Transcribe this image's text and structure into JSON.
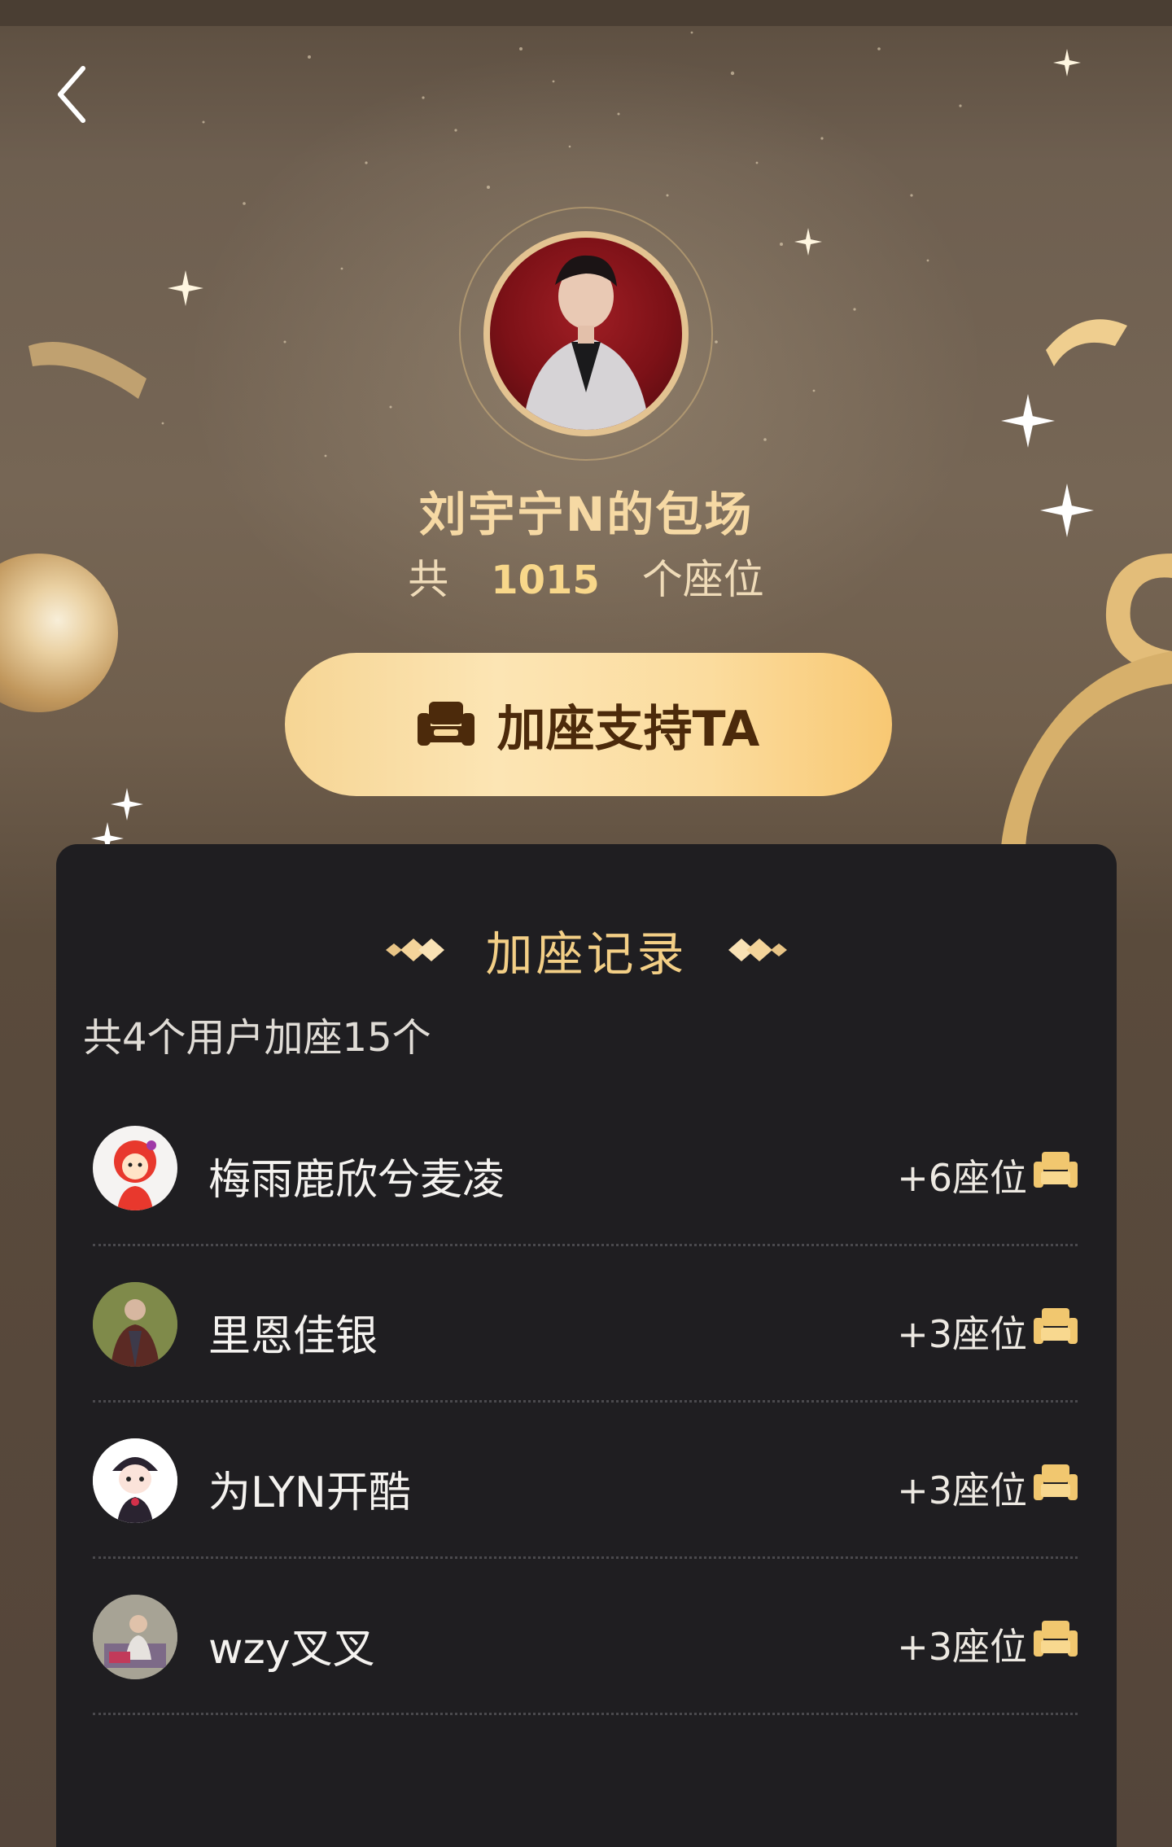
{
  "header": {
    "title": "刘宇宁N的包场",
    "seat_prefix": "共",
    "seat_total": "1015",
    "seat_suffix": "个座位"
  },
  "support_button": {
    "label": "加座支持TA"
  },
  "records": {
    "title": "加座记录",
    "summary": "共4个用户加座15个",
    "items": [
      {
        "name": "梅雨鹿欣兮麦凌",
        "count": "+6座位"
      },
      {
        "name": "里恩佳银",
        "count": "+3座位"
      },
      {
        "name": "为LYN开酷",
        "count": "+3座位"
      },
      {
        "name": "wzy叉叉",
        "count": "+3座位"
      }
    ]
  },
  "colors": {
    "accent_gold": "#f3cf86",
    "button_gradient_start": "#f6d594",
    "button_gradient_end": "#f8c873",
    "card_bg": "#1f1e21"
  },
  "icons": [
    "back-chevron-icon",
    "sofa-icon",
    "diamond-ornament-icon"
  ]
}
